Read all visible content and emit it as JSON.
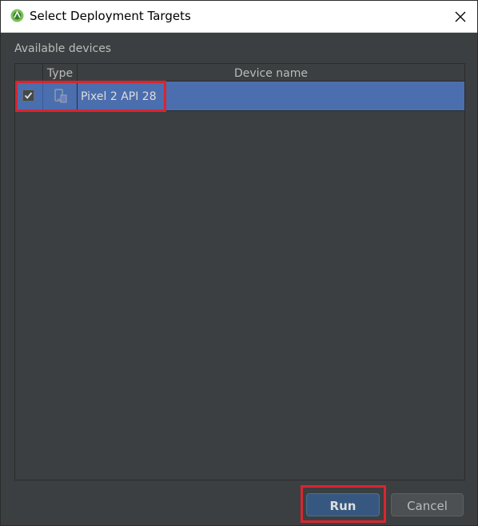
{
  "window": {
    "title": "Select Deployment Targets"
  },
  "section": {
    "label": "Available devices"
  },
  "table": {
    "columns": {
      "check": "",
      "type": "Type",
      "name": "Device name"
    },
    "rows": [
      {
        "checked": true,
        "type_icon": "phone-device-icon",
        "name": "Pixel 2 API 28"
      }
    ]
  },
  "buttons": {
    "run_label": "Run",
    "cancel_label": "Cancel"
  },
  "colors": {
    "background": "#3c3f41",
    "selection": "#4b6eaf",
    "highlight": "#d9252f",
    "run_button": "#365880"
  }
}
